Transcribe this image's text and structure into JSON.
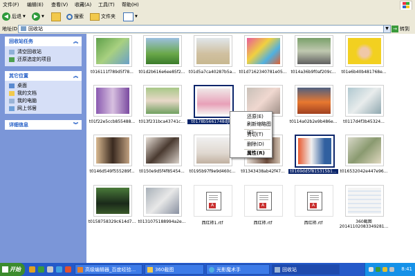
{
  "menubar": {
    "items": [
      "文件(F)",
      "编辑(E)",
      "查看(V)",
      "收藏(A)",
      "工具(T)",
      "帮助(H)"
    ]
  },
  "toolbar": {
    "back_label": "后退",
    "search_label": "搜索",
    "folders_label": "文件夹"
  },
  "address": {
    "label": "地址(D)",
    "value": "回收站",
    "go_label": "转到"
  },
  "sidebar": {
    "tasks_title": "回收站任务",
    "tasks": [
      "清空回收站",
      "还原选定的项目"
    ],
    "places_title": "其它位置",
    "places": [
      "桌面",
      "我的文档",
      "我的电脑",
      "网上邻居"
    ],
    "details_title": "详细信息"
  },
  "files": [
    "t016111f789d5f78...",
    "t01d2b616e6ee85f2...",
    "t01d5a7ca40287b5a...",
    "t01d7162340781e05...",
    "t014a36b9f0af209c...",
    "t01e6b40b481768e...",
    "t01f22e5ccb855488...",
    "t013f231bca43741c...",
    "t0178b5661748dJPE",
    "t01b05...",
    "t0114a02b2e9b486e...",
    "t0117d4f3b45324...",
    "t0146d549f555289f...",
    "t0150e9d5f4f85454...",
    "t0195b97f9e9d460c...",
    "t01343438ab42f47...",
    "t0169dd5f815315b1...",
    "t016532042e447e96...",
    "t0158758329c614d7...",
    "t0131075188994a2e...",
    "西红柿1.rtf",
    "西红柿.rtf",
    "西红柿.rtf",
    "360截图 20141102083349281..."
  ],
  "context_menu": {
    "items": [
      "还原(E)",
      "刷新缩略图(E)",
      "剪切(T)",
      "删除(D)",
      "属性(R)"
    ]
  },
  "taskbar": {
    "start_label": "开始",
    "tasks": [
      "高级编辑器_百度经验...",
      "360截图",
      "光影魔术手",
      "回收站"
    ],
    "clock": "8:41"
  }
}
